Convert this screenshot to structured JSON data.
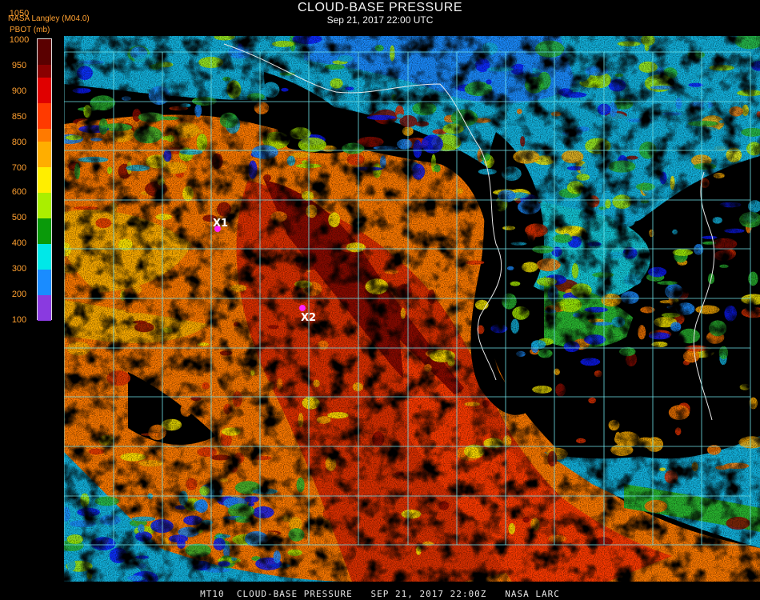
{
  "header": {
    "title": "CLOUD-BASE PRESSURE",
    "subtitle": "Sep 21, 2017 22:00 UTC",
    "agency": "NASA Langley (M04.0)",
    "units": "PBOT (mb)"
  },
  "colorbar": {
    "labels": [
      "1050",
      "1000",
      "950",
      "900",
      "850",
      "800",
      "700",
      "600",
      "500",
      "400",
      "300",
      "200",
      "100"
    ],
    "colors": [
      "#5a0000",
      "#e00000",
      "#ff3a00",
      "#ff7a00",
      "#ffae00",
      "#ffee00",
      "#aaee00",
      "#0a9a0a",
      "#00e8e8",
      "#1a8cff",
      "#0a1aff",
      "#0000b0",
      "#8a3ae0"
    ]
  },
  "map": {
    "markers": [
      {
        "label": "X1",
        "color": "#ff20ff"
      },
      {
        "label": "X2",
        "color": "#ff20ff"
      }
    ],
    "grid_color": "#6fe0e8",
    "coast_color": "#e8e8e8",
    "lat_labels_color": "#c8102e"
  },
  "footer": {
    "text": "MT10  CLOUD-BASE PRESSURE   SEP 21, 2017 22:00Z   NASA LARC"
  }
}
